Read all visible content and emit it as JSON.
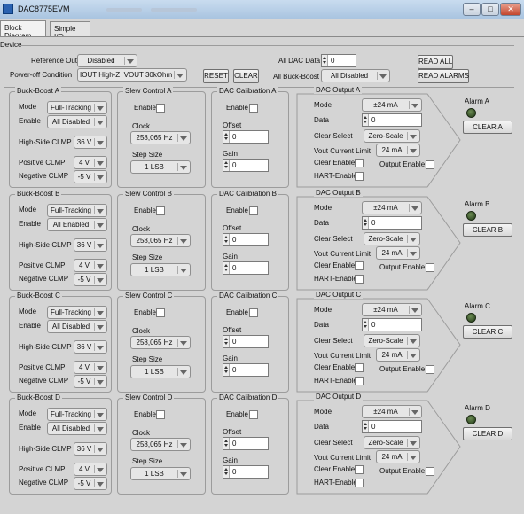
{
  "window": {
    "title": "DAC8775EVM",
    "minimize": "–",
    "maximize": "□",
    "close": "✕"
  },
  "tabs": [
    {
      "label": "Block Diagram"
    },
    {
      "label": "Simple I/O"
    }
  ],
  "device": {
    "group_label": "Device",
    "reference_out_label": "Reference Out",
    "reference_out_value": "Disabled",
    "power_off_label": "Power-off Condition",
    "power_off_value": "IOUT High-Z, VOUT 30kOhm",
    "reset_button": "RESET",
    "clear_button": "CLEAR",
    "all_dac_data_label": "All DAC Data",
    "all_dac_data_value": "0",
    "all_buck_boost_label": "All Buck-Boost",
    "all_buck_boost_value": "All Disabled",
    "read_all_button": "READ ALL",
    "read_alarms_button": "READ ALARMS"
  },
  "channels": [
    {
      "buck": {
        "title": "Buck-Boost A",
        "mode_label": "Mode",
        "mode": "Full-Tracking",
        "enable_label": "Enable",
        "enable": "All Disabled",
        "hs_label": "High-Side CLMP",
        "hs": "36 V",
        "pos_label": "Positive CLMP",
        "pos": "4 V",
        "neg_label": "Negative CLMP",
        "neg": "-5 V"
      },
      "slew": {
        "title": "Slew Control A",
        "enable_label": "Enable",
        "clock_label": "Clock",
        "clock": "258,065 Hz",
        "step_label": "Step Size",
        "step": "1 LSB"
      },
      "cal": {
        "title": "DAC Calibration A",
        "enable_label": "Enable",
        "offset_label": "Offset",
        "offset": "0",
        "gain_label": "Gain",
        "gain": "0"
      },
      "out": {
        "title": "DAC Output A",
        "mode_label": "Mode",
        "mode": "±24 mA",
        "data_label": "Data",
        "data": "0",
        "clear_sel_label": "Clear Select",
        "clear_sel": "Zero-Scale",
        "vout_label": "Vout Current Limit",
        "vout": "24 mA",
        "clear_en_label": "Clear Enable",
        "output_en_label": "Output Enable",
        "hart_label": "HART-Enable"
      },
      "alarm": {
        "title": "Alarm A",
        "clear_button": "CLEAR A"
      }
    },
    {
      "buck": {
        "title": "Buck-Boost B",
        "mode_label": "Mode",
        "mode": "Full-Tracking",
        "enable_label": "Enable",
        "enable": "All Enabled",
        "hs_label": "High-Side CLMP",
        "hs": "36 V",
        "pos_label": "Positive CLMP",
        "pos": "4 V",
        "neg_label": "Negative CLMP",
        "neg": "-5 V"
      },
      "slew": {
        "title": "Slew Control B",
        "enable_label": "Enable",
        "clock_label": "Clock",
        "clock": "258,065 Hz",
        "step_label": "Step Size",
        "step": "1 LSB"
      },
      "cal": {
        "title": "DAC Calibration B",
        "enable_label": "Enable",
        "offset_label": "Offset",
        "offset": "0",
        "gain_label": "Gain",
        "gain": "0"
      },
      "out": {
        "title": "DAC Output B",
        "mode_label": "Mode",
        "mode": "±24 mA",
        "data_label": "Data",
        "data": "0",
        "clear_sel_label": "Clear Select",
        "clear_sel": "Zero-Scale",
        "vout_label": "Vout Current Limit",
        "vout": "24 mA",
        "clear_en_label": "Clear Enable",
        "output_en_label": "Output Enable",
        "hart_label": "HART-Enable"
      },
      "alarm": {
        "title": "Alarm B",
        "clear_button": "CLEAR B"
      }
    },
    {
      "buck": {
        "title": "Buck-Boost C",
        "mode_label": "Mode",
        "mode": "Full-Tracking",
        "enable_label": "Enable",
        "enable": "All Disabled",
        "hs_label": "High-Side CLMP",
        "hs": "36 V",
        "pos_label": "Positive CLMP",
        "pos": "4 V",
        "neg_label": "Negative CLMP",
        "neg": "-5 V"
      },
      "slew": {
        "title": "Slew Control C",
        "enable_label": "Enable",
        "clock_label": "Clock",
        "clock": "258,065 Hz",
        "step_label": "Step Size",
        "step": "1 LSB"
      },
      "cal": {
        "title": "DAC Calibration C",
        "enable_label": "Enable",
        "offset_label": "Offset",
        "offset": "0",
        "gain_label": "Gain",
        "gain": "0"
      },
      "out": {
        "title": "DAC Output C",
        "mode_label": "Mode",
        "mode": "±24 mA",
        "data_label": "Data",
        "data": "0",
        "clear_sel_label": "Clear Select",
        "clear_sel": "Zero-Scale",
        "vout_label": "Vout Current Limit",
        "vout": "24 mA",
        "clear_en_label": "Clear Enable",
        "output_en_label": "Output Enable",
        "hart_label": "HART-Enable"
      },
      "alarm": {
        "title": "Alarm C",
        "clear_button": "CLEAR C"
      }
    },
    {
      "buck": {
        "title": "Buck-Boost D",
        "mode_label": "Mode",
        "mode": "Full-Tracking",
        "enable_label": "Enable",
        "enable": "All Disabled",
        "hs_label": "High-Side CLMP",
        "hs": "36 V",
        "pos_label": "Positive CLMP",
        "pos": "4 V",
        "neg_label": "Negative CLMP",
        "neg": "-5 V"
      },
      "slew": {
        "title": "Slew Control D",
        "enable_label": "Enable",
        "clock_label": "Clock",
        "clock": "258,065 Hz",
        "step_label": "Step Size",
        "step": "1 LSB"
      },
      "cal": {
        "title": "DAC Calibration D",
        "enable_label": "Enable",
        "offset_label": "Offset",
        "offset": "0",
        "gain_label": "Gain",
        "gain": "0"
      },
      "out": {
        "title": "DAC Output D",
        "mode_label": "Mode",
        "mode": "±24 mA",
        "data_label": "Data",
        "data": "0",
        "clear_sel_label": "Clear Select",
        "clear_sel": "Zero-Scale",
        "vout_label": "Vout Current Limit",
        "vout": "24 mA",
        "clear_en_label": "Clear Enable",
        "output_en_label": "Output Enable",
        "hart_label": "HART-Enable"
      },
      "alarm": {
        "title": "Alarm D",
        "clear_button": "CLEAR D"
      }
    }
  ],
  "colors": {
    "alarm_led": "#3f5e2c",
    "panel_bg": "#d4d4d4",
    "titlebar": "#b9d0e8"
  },
  "icons": {
    "app": "app-icon",
    "alarm": "led-icon"
  }
}
